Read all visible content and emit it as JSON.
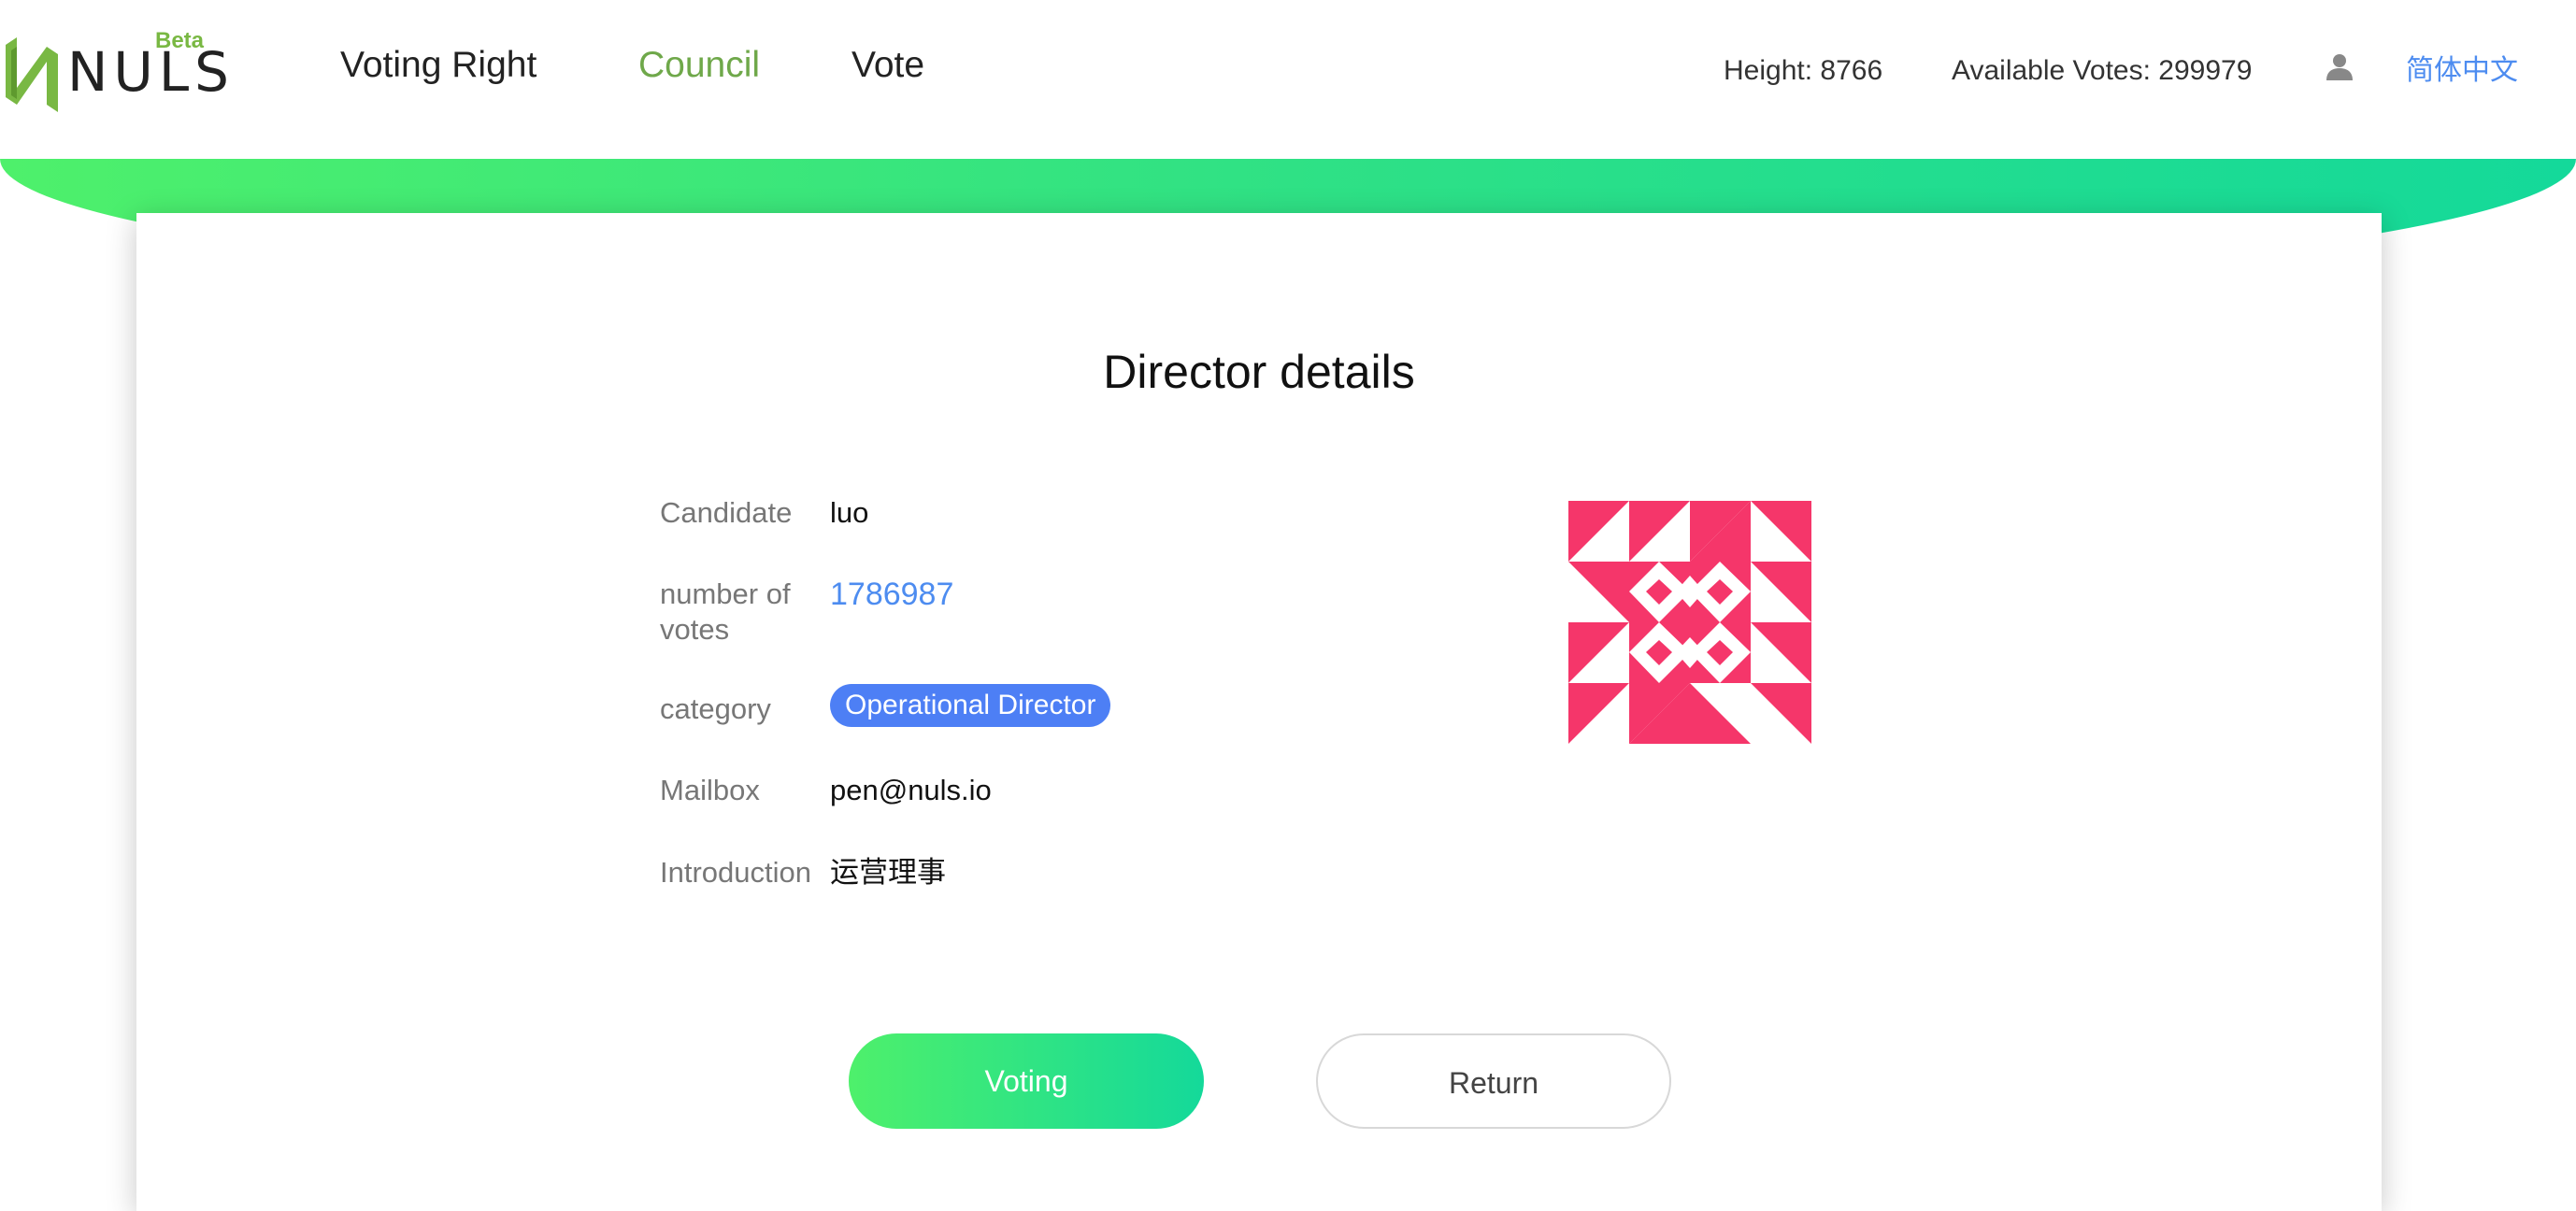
{
  "header": {
    "logo": {
      "beta": "Beta",
      "wordmark": "NULS",
      "brand_color": "#79b843"
    },
    "nav": [
      {
        "label": "Voting Right",
        "active": false
      },
      {
        "label": "Council",
        "active": true
      },
      {
        "label": "Vote",
        "active": false
      }
    ],
    "height": "Height: 8766",
    "available_votes": "Available Votes: 299979",
    "user_icon": "user-icon",
    "language": "简体中文"
  },
  "colors": {
    "accent_green": "#6fa84a",
    "banner_gradient_start": "#4ef06b",
    "banner_gradient_end": "#14d99a",
    "link_blue": "#4d8cf0",
    "badge_blue": "#4d7ff5",
    "identicon_pink": "#f5366a"
  },
  "detail": {
    "title": "Director details",
    "candidate_label": "Candidate",
    "candidate_value": "luo",
    "votes_label": "number of votes",
    "votes_value": "1786987",
    "category_label": "category",
    "category_value": "Operational Director",
    "mailbox_label": "Mailbox",
    "mailbox_value": "pen@nuls.io",
    "introduction_label": "Introduction",
    "introduction_value": "运营理事"
  },
  "actions": {
    "voting_label": "Voting",
    "return_label": "Return"
  }
}
